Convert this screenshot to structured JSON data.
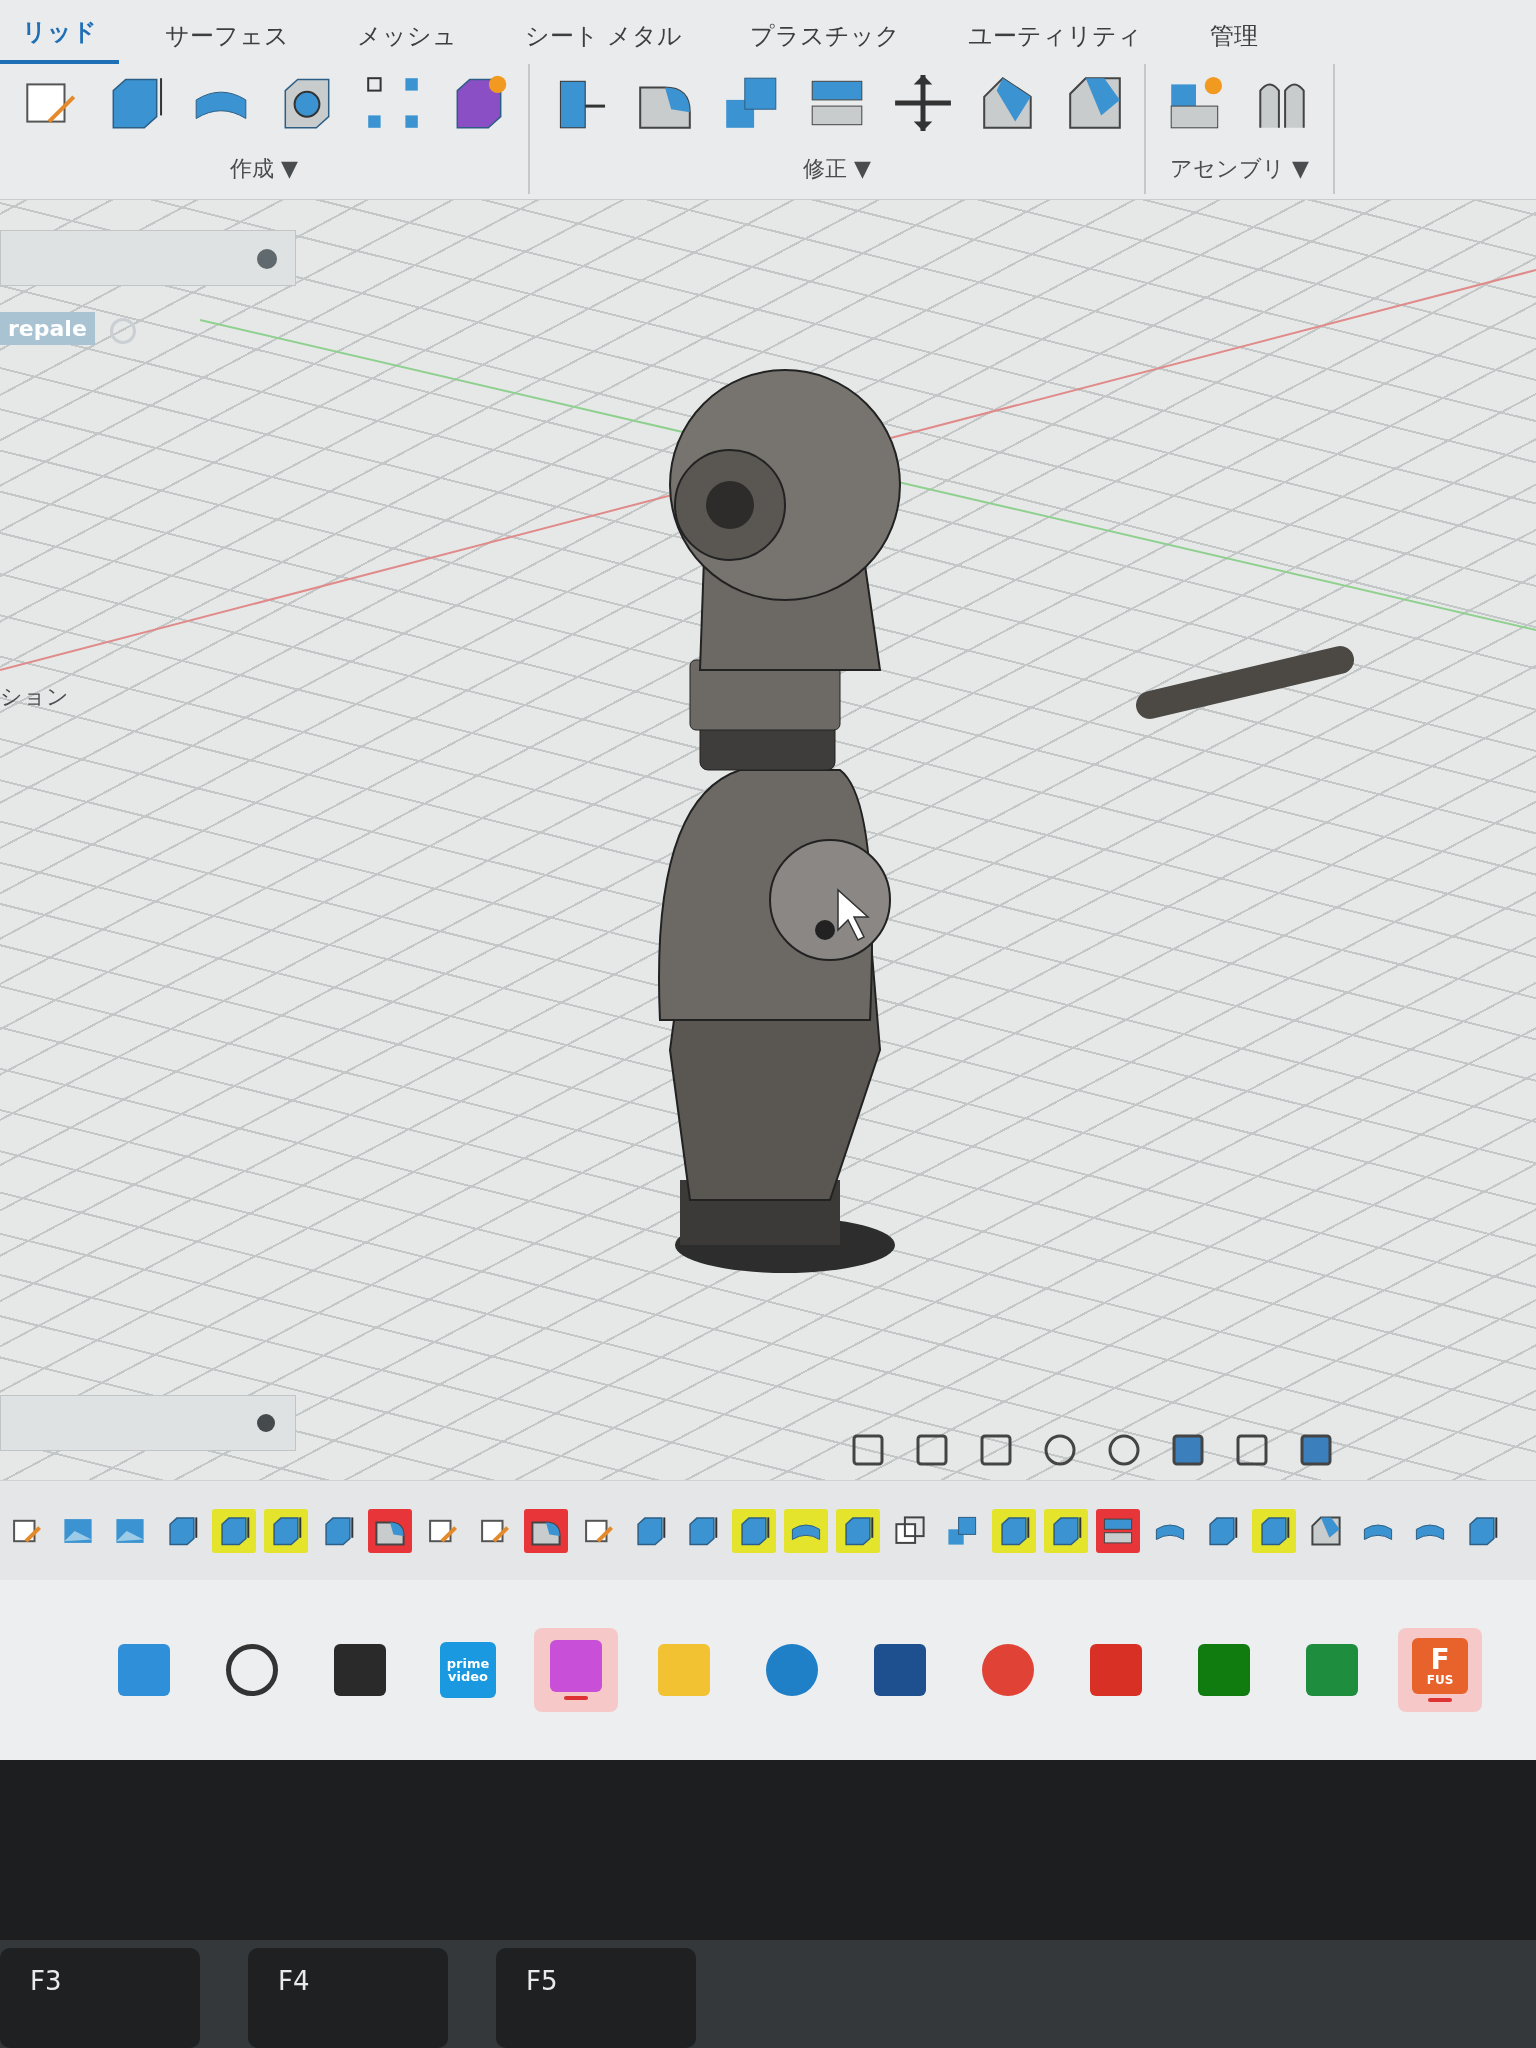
{
  "toolbar": {
    "tabs": [
      {
        "label": "リッド",
        "selected": true
      },
      {
        "label": "サーフェス",
        "selected": false
      },
      {
        "label": "メッシュ",
        "selected": false
      },
      {
        "label": "シート メタル",
        "selected": false
      },
      {
        "label": "プラスチック",
        "selected": false
      },
      {
        "label": "ユーティリティ",
        "selected": false
      },
      {
        "label": "管理",
        "selected": false
      }
    ],
    "groups": [
      {
        "label": "作成 ▼",
        "tools": [
          {
            "kind": "sketch"
          },
          {
            "kind": "extrude"
          },
          {
            "kind": "revolve"
          },
          {
            "kind": "hole"
          },
          {
            "kind": "pattern"
          },
          {
            "kind": "form"
          }
        ]
      },
      {
        "label": "修正 ▼",
        "tools": [
          {
            "kind": "presspull"
          },
          {
            "kind": "fillet"
          },
          {
            "kind": "combine"
          },
          {
            "kind": "split"
          },
          {
            "kind": "move"
          },
          {
            "kind": "draft"
          },
          {
            "kind": "chamfer"
          }
        ]
      },
      {
        "label": "アセンブリ ▼",
        "tools": [
          {
            "kind": "component"
          },
          {
            "kind": "joint"
          }
        ]
      }
    ]
  },
  "browser_items": [
    {
      "label": "repale",
      "kind": "component"
    },
    {
      "label": "ション",
      "kind": "folder"
    }
  ],
  "timeline": [
    {
      "kind": "sketch"
    },
    {
      "kind": "image"
    },
    {
      "kind": "image"
    },
    {
      "kind": "extrude"
    },
    {
      "kind": "extrude",
      "color": "#e4e42c"
    },
    {
      "kind": "extrude",
      "color": "#e4e42c"
    },
    {
      "kind": "extrude"
    },
    {
      "kind": "fillet",
      "color": "#e8353a"
    },
    {
      "kind": "sketch"
    },
    {
      "kind": "sketch"
    },
    {
      "kind": "fillet",
      "color": "#e8353a"
    },
    {
      "kind": "sketch"
    },
    {
      "kind": "extrude"
    },
    {
      "kind": "extrude"
    },
    {
      "kind": "extrude",
      "color": "#e4e42c"
    },
    {
      "kind": "revolve",
      "color": "#e4e42c"
    },
    {
      "kind": "extrude",
      "color": "#e4e42c"
    },
    {
      "kind": "copy"
    },
    {
      "kind": "combine"
    },
    {
      "kind": "extrude",
      "color": "#e4e42c"
    },
    {
      "kind": "extrude",
      "color": "#e4e42c"
    },
    {
      "kind": "split",
      "color": "#e8353a"
    },
    {
      "kind": "revolve"
    },
    {
      "kind": "extrude"
    },
    {
      "kind": "extrude",
      "color": "#e4e42c"
    },
    {
      "kind": "chamfer"
    },
    {
      "kind": "revolve"
    },
    {
      "kind": "revolve"
    },
    {
      "kind": "extrude"
    }
  ],
  "taskbar": [
    {
      "kind": "start",
      "selected": false
    },
    {
      "kind": "search",
      "selected": false
    },
    {
      "kind": "taskview",
      "selected": false
    },
    {
      "kind": "prime",
      "label": "prime video",
      "selected": false
    },
    {
      "kind": "copilot",
      "selected": true
    },
    {
      "kind": "explorer",
      "selected": false
    },
    {
      "kind": "edge",
      "selected": false
    },
    {
      "kind": "store",
      "selected": false
    },
    {
      "kind": "chrome",
      "selected": false
    },
    {
      "kind": "gmail",
      "selected": false
    },
    {
      "kind": "xbox",
      "selected": false
    },
    {
      "kind": "classroom",
      "selected": false
    },
    {
      "kind": "fusion",
      "label": "F",
      "sublabel": "FUS",
      "selected": true
    }
  ],
  "keyboard": {
    "keys": [
      "F3",
      "F4",
      "F5"
    ]
  }
}
